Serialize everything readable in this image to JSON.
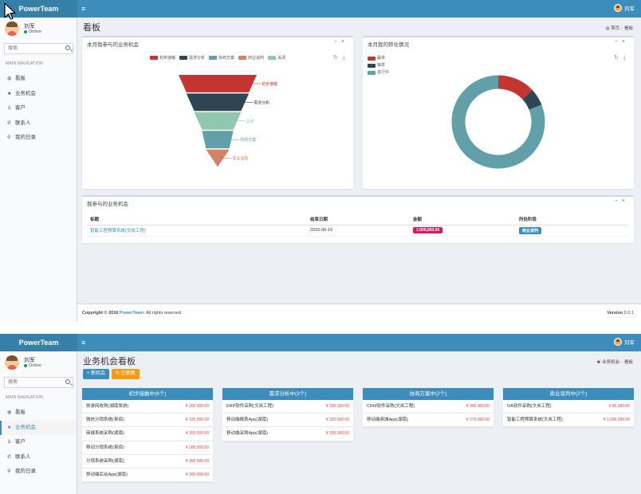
{
  "app": {
    "brand": "PowerTeam",
    "menu_icon": "≡"
  },
  "user": {
    "name": "刘军",
    "status": "Online"
  },
  "sidebar": {
    "search_placeholder": "搜索",
    "header": "MAIN NAVIGATION",
    "items": [
      {
        "icon": "dashboard-icon",
        "glyph": "◍",
        "label": "看板"
      },
      {
        "icon": "star-icon",
        "glyph": "★",
        "label": "业务机会"
      },
      {
        "icon": "user-icon",
        "glyph": "♙",
        "label": "客户"
      },
      {
        "icon": "phone-icon",
        "glyph": "✆",
        "label": "联系人"
      },
      {
        "icon": "thumbtack-icon",
        "glyph": "⚲",
        "label": "我的日录"
      }
    ]
  },
  "dashboard": {
    "title": "看板",
    "breadcrumb": [
      "首页",
      "看板"
    ],
    "funnel_box": {
      "title": "本月我参与的业务机会",
      "legend": [
        "初步接触",
        "需求分析",
        "协商方案",
        "商业谈判",
        "关闭"
      ],
      "stage_labels": [
        "初步接触",
        "需求分析",
        "关闭",
        "协商方案",
        "商业谈判"
      ]
    },
    "donut_box": {
      "title": "本月我的转化情况",
      "legend": [
        "赢单",
        "输单",
        "进行中"
      ]
    },
    "table_box": {
      "title": "我参与的业务机会",
      "headers": [
        "标题",
        "结束日期",
        "金额",
        "所处阶段"
      ],
      "rows": [
        {
          "title": "智能工程预算系统(文岚工程)",
          "end_date": "2016-06-16",
          "amount": "1,000,000.00",
          "stage": "商业谈判"
        }
      ]
    },
    "footer": {
      "copyright_prefix": "Copyright © 2016",
      "company": "PowerTeam.",
      "rights": "All rights reserved.",
      "version_label": "Version",
      "version": "0.0.1"
    }
  },
  "kanban": {
    "title": "业务机会看板",
    "breadcrumb": [
      "业务机会",
      "看板"
    ],
    "buttons": {
      "new": "+ 新机会",
      "refresh": "↻ 已刷新"
    },
    "columns": [
      {
        "title": "初步接触中(6个)",
        "items": [
          {
            "name": "旅游网收购(湖南旅游)",
            "amount": "¥ 200,000.00"
          },
          {
            "name": "微信分销系统(易佰)",
            "amount": "¥ 125,000.00"
          },
          {
            "name": "商城系统采购(湖南)",
            "amount": "¥ 155,000.00"
          },
          {
            "name": "移动分销系统(易佰)",
            "amount": "¥ 200,000.00"
          },
          {
            "name": "分销系统采购(湖南)",
            "amount": "¥ 300,000.00"
          },
          {
            "name": "移动端后台App(湖南)",
            "amount": "¥ 300,000.00"
          }
        ]
      },
      {
        "title": "需求分析中(3个)",
        "items": [
          {
            "name": "ERP软件采购(文岚工程)",
            "amount": "¥ 200,000.00"
          },
          {
            "name": "移动端报表App(湖南)",
            "amount": "¥ 320,000.00"
          },
          {
            "name": "移动端采购App(湖南)",
            "amount": "¥ 250,000.00"
          }
        ]
      },
      {
        "title": "协商方案中(2个)",
        "items": [
          {
            "name": "CRM软件采购(文岚工程)",
            "amount": "¥ 300,000.00"
          },
          {
            "name": "移动端商城App(湖南)",
            "amount": "¥ 170,000.00"
          }
        ]
      },
      {
        "title": "商业谈判中(2个)",
        "items": [
          {
            "name": "OA软件采购(文岚工程)",
            "amount": "¥ 95,000.00"
          },
          {
            "name": "智能工程预算系统(文岚工程)",
            "amount": "¥ 1,000,000.00"
          }
        ]
      }
    ]
  },
  "chart_data": [
    {
      "type": "funnel",
      "title": "本月我参与的业务机会",
      "stages": [
        "初步接触",
        "需求分析",
        "关闭",
        "协商方案",
        "商业谈判"
      ],
      "relative_values": [
        100,
        80,
        60,
        40,
        30
      ],
      "colors": [
        "#c23531",
        "#2f4554",
        "#91c7ae",
        "#61a0a8",
        "#d48265"
      ]
    },
    {
      "type": "pie",
      "variant": "donut",
      "title": "本月我的转化情况",
      "labels": [
        "赢单",
        "输单",
        "进行中"
      ],
      "values": [
        13,
        6,
        81
      ],
      "colors": [
        "#c23531",
        "#2f4554",
        "#61a0a8"
      ]
    }
  ]
}
